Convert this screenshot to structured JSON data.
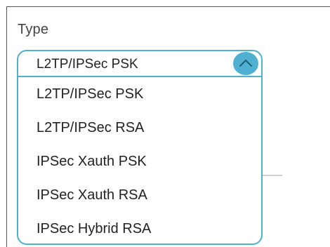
{
  "type_label": "Type",
  "dropdown": {
    "selected": "L2TP/IPSec PSK",
    "toggle_icon": "chevron-up-icon",
    "options": [
      "L2TP/IPSec PSK",
      "L2TP/IPSec RSA",
      "IPSec Xauth PSK",
      "IPSec Xauth RSA",
      "IPSec Hybrid RSA"
    ]
  },
  "colors": {
    "accent": "#4fb0d2",
    "text": "#222222",
    "label": "#444444"
  }
}
